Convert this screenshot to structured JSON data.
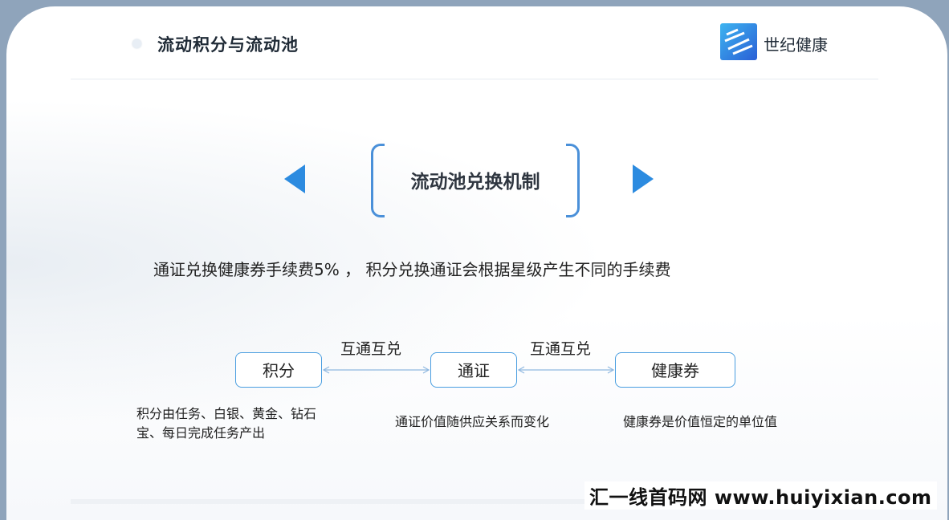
{
  "header": {
    "title": "流动积分与流动池",
    "brand": "世纪健康",
    "logo_icon": "brand-logo-icon",
    "accent": "#2c8be0"
  },
  "mechanism": {
    "title": "流动池兑换机制",
    "prev_icon": "triangle-left-icon",
    "next_icon": "triangle-right-icon"
  },
  "description": "通证兑换健康券手续费5% ，  积分兑换通证会根据星级产生不同的手续费",
  "flow": {
    "nodes": [
      "积分",
      "通证",
      "健康券"
    ],
    "links": [
      "互通互兑",
      "互通互兑"
    ],
    "notes": [
      "积分由任务、白银、黄金、钻石宝、每日完成任务产出",
      "通证价值随供应关系而变化",
      "健康券是价值恒定的单位值"
    ]
  },
  "watermark": "汇一线首码网  www.huiyixian.com"
}
